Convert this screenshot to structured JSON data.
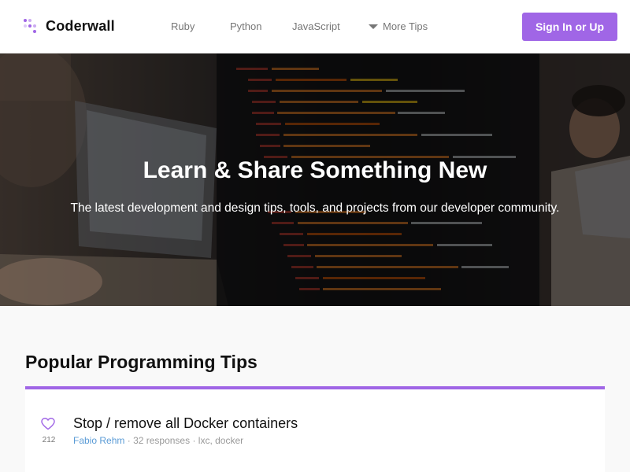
{
  "brand": {
    "name": "Coderwall",
    "accent_color": "#a066e6"
  },
  "nav": {
    "links": [
      "Ruby",
      "Python",
      "JavaScript"
    ],
    "more_label": "More Tips"
  },
  "auth": {
    "sign_in_label": "Sign In or Up"
  },
  "hero": {
    "title": "Learn & Share Something New",
    "subtitle": "The latest development and design tips, tools, and projects from our developer community."
  },
  "popular": {
    "heading": "Popular Programming Tips",
    "tips": [
      {
        "title": "Stop / remove all Docker containers",
        "votes": "212",
        "author": "Fabio Rehm",
        "responses": "32 responses",
        "tags": "lxc, docker",
        "separator": "·"
      }
    ]
  }
}
